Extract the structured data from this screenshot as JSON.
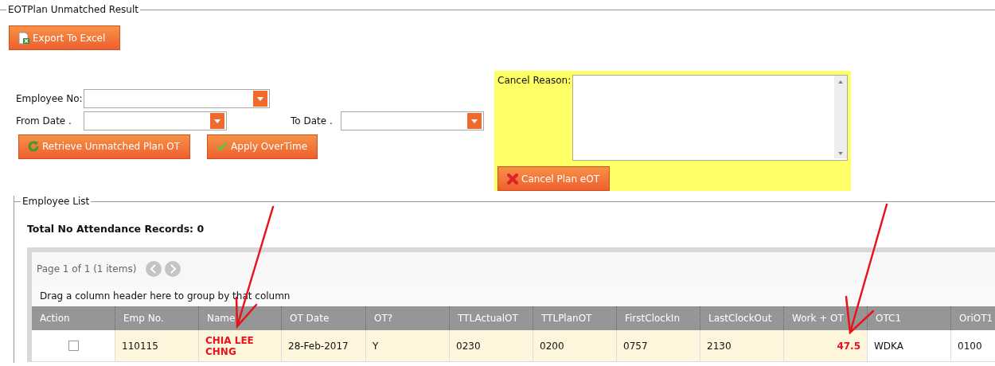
{
  "section_title": "EOTPlan Unmatched Result",
  "export_button": "Export To Excel",
  "filters": {
    "employee_no": {
      "label": "Employee No:"
    },
    "from_date": {
      "label": "From Date ."
    },
    "to_date": {
      "label": "To Date ."
    }
  },
  "actions": [
    {
      "label": "Retrieve Unmatched Plan OT"
    },
    {
      "label": "Apply OverTime"
    }
  ],
  "cancel_panel": {
    "label": "Cancel Reason:",
    "button": "Cancel Plan eOT"
  },
  "employee_list": {
    "title": "Employee List",
    "total": "Total No Attendance Records: 0",
    "pager": "Page 1 of 1 (1 items)",
    "group_hint": "Drag a column header here to group by that column",
    "columns": [
      "Action",
      "Emp No.",
      "Name",
      "OT Date",
      "OT?",
      "TTLActualOT",
      "TTLPlanOT",
      "FirstClockIn",
      "LastClockOut",
      "Work + OT",
      "OTC1",
      "OriOT1"
    ],
    "rows": [
      {
        "cells": [
          {
            "kind": "checkbox",
            "checked": false,
            "highlighted": false
          },
          {
            "kind": "text",
            "text": "110115",
            "highlighted": true,
            "alert": false
          },
          {
            "kind": "text",
            "text": "CHIA LEE CHNG",
            "highlighted": true,
            "alert": true
          },
          {
            "kind": "text",
            "text": "28-Feb-2017",
            "highlighted": true,
            "alert": false
          },
          {
            "kind": "text",
            "text": "Y",
            "highlighted": true,
            "alert": false
          },
          {
            "kind": "text",
            "text": "0230",
            "highlighted": true,
            "alert": false
          },
          {
            "kind": "text",
            "text": "0200",
            "highlighted": true,
            "alert": false
          },
          {
            "kind": "text",
            "text": "0757",
            "highlighted": true,
            "alert": false
          },
          {
            "kind": "text",
            "text": "2130",
            "highlighted": true,
            "alert": false
          },
          {
            "kind": "number",
            "text": "47.5",
            "highlighted": true,
            "alert": true
          },
          {
            "kind": "text",
            "text": "WDKA",
            "highlighted": false,
            "alert": false
          },
          {
            "kind": "text",
            "text": "0100",
            "highlighted": false,
            "alert": false
          }
        ]
      }
    ]
  }
}
